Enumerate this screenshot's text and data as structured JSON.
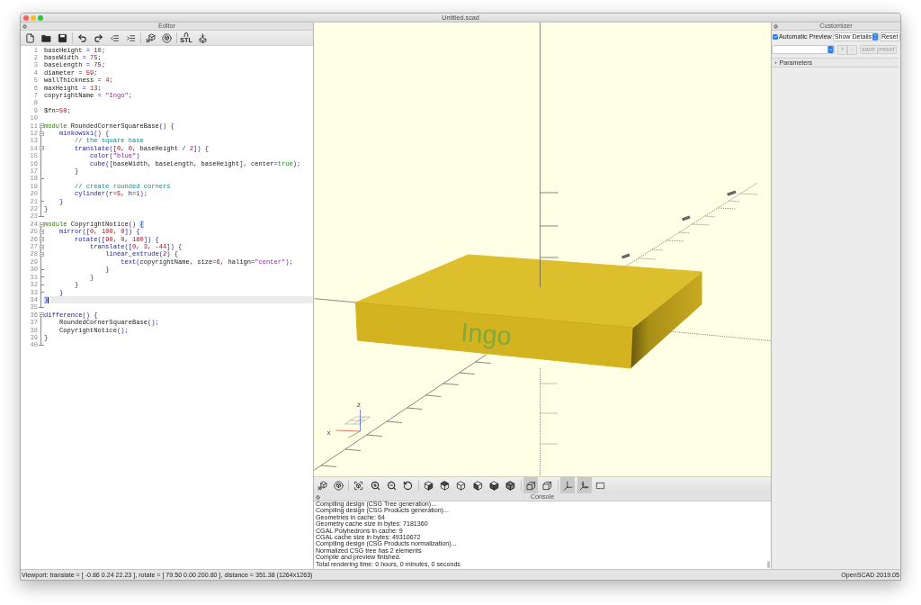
{
  "window": {
    "title": "Untitled.scad"
  },
  "editor": {
    "title": "Editor",
    "toolbar": {
      "groups": [
        [
          {
            "kind": "new"
          },
          {
            "kind": "open"
          },
          {
            "kind": "save"
          }
        ],
        [
          {
            "kind": "undo"
          },
          {
            "kind": "redo"
          },
          {
            "kind": "unindent"
          },
          {
            "kind": "indent"
          }
        ],
        [
          {
            "kind": "preview"
          },
          {
            "kind": "render"
          }
        ],
        [
          {
            "kind": "export_stl",
            "label": "STL"
          },
          {
            "kind": "print"
          }
        ]
      ]
    },
    "lines": [
      {
        "number": "1",
        "kind": "plain",
        "current": false,
        "tokens": [
          {
            "kind": "id",
            "text": "baseHeight"
          },
          {
            "kind": "op",
            "text": " = "
          },
          {
            "kind": "num",
            "text": "10"
          },
          {
            "kind": "op",
            "text": ";"
          }
        ]
      },
      {
        "number": "2",
        "kind": "plain",
        "current": false,
        "tokens": [
          {
            "kind": "id",
            "text": "baseWidth"
          },
          {
            "kind": "op",
            "text": " = "
          },
          {
            "kind": "num",
            "text": "75"
          },
          {
            "kind": "op",
            "text": ";"
          }
        ]
      },
      {
        "number": "3",
        "kind": "plain",
        "current": false,
        "tokens": [
          {
            "kind": "id",
            "text": "baseLength"
          },
          {
            "kind": "op",
            "text": " = "
          },
          {
            "kind": "num",
            "text": "75"
          },
          {
            "kind": "op",
            "text": ";"
          }
        ]
      },
      {
        "number": "4",
        "kind": "plain",
        "current": false,
        "tokens": [
          {
            "kind": "id",
            "text": "diameter"
          },
          {
            "kind": "op",
            "text": " = "
          },
          {
            "kind": "num",
            "text": "59"
          },
          {
            "kind": "op",
            "text": ";"
          }
        ]
      },
      {
        "number": "5",
        "kind": "plain",
        "current": false,
        "tokens": [
          {
            "kind": "id",
            "text": "wallThickness"
          },
          {
            "kind": "op",
            "text": " = "
          },
          {
            "kind": "num",
            "text": "4"
          },
          {
            "kind": "op",
            "text": ";"
          }
        ]
      },
      {
        "number": "6",
        "kind": "plain",
        "current": false,
        "tokens": [
          {
            "kind": "id",
            "text": "maxHeight"
          },
          {
            "kind": "op",
            "text": " = "
          },
          {
            "kind": "num",
            "text": "13"
          },
          {
            "kind": "op",
            "text": ";"
          }
        ]
      },
      {
        "number": "7",
        "kind": "plain",
        "current": false,
        "tokens": [
          {
            "kind": "id",
            "text": "copyrightName"
          },
          {
            "kind": "op",
            "text": " = "
          },
          {
            "kind": "str",
            "text": "\"Ingo\""
          },
          {
            "kind": "op",
            "text": ";"
          }
        ]
      },
      {
        "number": "8",
        "kind": "plain",
        "current": false
      },
      {
        "number": "9",
        "kind": "plain",
        "current": false,
        "tokens": [
          {
            "kind": "id",
            "text": "$fn"
          },
          {
            "kind": "op",
            "text": "="
          },
          {
            "kind": "num",
            "text": "50"
          },
          {
            "kind": "op",
            "text": ";"
          }
        ]
      },
      {
        "number": "10",
        "kind": "plain",
        "current": false
      },
      {
        "number": "11",
        "kind": "start",
        "current": false,
        "tokens": [
          {
            "kind": "kw",
            "text": "module"
          },
          {
            "kind": "id",
            "text": " RoundedCornerSquareBase"
          },
          {
            "kind": "op",
            "text": "() {"
          }
        ]
      },
      {
        "number": "12",
        "kind": "start",
        "current": false,
        "tokens": [
          {
            "kind": "fn",
            "text": "    minkowski"
          },
          {
            "kind": "op",
            "text": "() {"
          }
        ]
      },
      {
        "number": "13",
        "kind": "body",
        "current": false,
        "tokens": [
          {
            "kind": "cmt",
            "text": "        // the square base"
          }
        ]
      },
      {
        "number": "14",
        "kind": "start",
        "current": false,
        "tokens": [
          {
            "kind": "fn",
            "text": "        translate"
          },
          {
            "kind": "op",
            "text": "(["
          },
          {
            "kind": "num",
            "text": "0"
          },
          {
            "kind": "op",
            "text": ", "
          },
          {
            "kind": "num",
            "text": "0"
          },
          {
            "kind": "op",
            "text": ", "
          },
          {
            "kind": "id",
            "text": "baseHeight"
          },
          {
            "kind": "op",
            "text": " / "
          },
          {
            "kind": "num",
            "text": "2"
          },
          {
            "kind": "op",
            "text": "]) {"
          }
        ]
      },
      {
        "number": "15",
        "kind": "body",
        "current": false,
        "tokens": [
          {
            "kind": "fn",
            "text": "            color"
          },
          {
            "kind": "op",
            "text": "("
          },
          {
            "kind": "str",
            "text": "\"blue\""
          },
          {
            "kind": "op",
            "text": ")"
          }
        ]
      },
      {
        "number": "16",
        "kind": "body",
        "current": false,
        "tokens": [
          {
            "kind": "fn",
            "text": "            cube"
          },
          {
            "kind": "op",
            "text": "(["
          },
          {
            "kind": "id",
            "text": "baseWidth"
          },
          {
            "kind": "op",
            "text": ", "
          },
          {
            "kind": "id",
            "text": "baseLength"
          },
          {
            "kind": "op",
            "text": ", "
          },
          {
            "kind": "id",
            "text": "baseHeight"
          },
          {
            "kind": "op",
            "text": "], "
          },
          {
            "kind": "id",
            "text": "center"
          },
          {
            "kind": "op",
            "text": "="
          },
          {
            "kind": "bool",
            "text": "true"
          },
          {
            "kind": "op",
            "text": ");"
          }
        ]
      },
      {
        "number": "17",
        "kind": "body",
        "current": false,
        "tokens": [
          {
            "kind": "op",
            "text": "        }"
          }
        ]
      },
      {
        "number": "18",
        "kind": "tick",
        "current": false
      },
      {
        "number": "19",
        "kind": "body",
        "current": false,
        "tokens": [
          {
            "kind": "cmt",
            "text": "        // create rounded corners"
          }
        ]
      },
      {
        "number": "20",
        "kind": "body",
        "current": false,
        "tokens": [
          {
            "kind": "fn",
            "text": "        cylinder"
          },
          {
            "kind": "op",
            "text": "("
          },
          {
            "kind": "id",
            "text": "r"
          },
          {
            "kind": "op",
            "text": "="
          },
          {
            "kind": "num",
            "text": "5"
          },
          {
            "kind": "op",
            "text": ", "
          },
          {
            "kind": "id",
            "text": "h"
          },
          {
            "kind": "op",
            "text": "="
          },
          {
            "kind": "num",
            "text": "1"
          },
          {
            "kind": "op",
            "text": ");"
          }
        ]
      },
      {
        "number": "21",
        "kind": "tick",
        "current": false,
        "tokens": [
          {
            "kind": "op",
            "text": "    }"
          }
        ]
      },
      {
        "number": "22",
        "kind": "body",
        "current": false,
        "tokens": [
          {
            "kind": "op",
            "text": "}"
          }
        ]
      },
      {
        "number": "23",
        "kind": "end",
        "current": false
      },
      {
        "number": "24",
        "kind": "start",
        "current": false,
        "tokens": [
          {
            "kind": "kw",
            "text": "module"
          },
          {
            "kind": "id",
            "text": " CopyrightNotice"
          },
          {
            "kind": "op",
            "text": "() "
          },
          {
            "kind": "match",
            "text": "{"
          }
        ]
      },
      {
        "number": "25",
        "kind": "start",
        "current": false,
        "tokens": [
          {
            "kind": "fn",
            "text": "    mirror"
          },
          {
            "kind": "op",
            "text": "(["
          },
          {
            "kind": "num",
            "text": "0"
          },
          {
            "kind": "op",
            "text": ", "
          },
          {
            "kind": "num",
            "text": "100"
          },
          {
            "kind": "op",
            "text": ", "
          },
          {
            "kind": "num",
            "text": "0"
          },
          {
            "kind": "op",
            "text": "]) {"
          }
        ]
      },
      {
        "number": "26",
        "kind": "start",
        "current": false,
        "tokens": [
          {
            "kind": "fn",
            "text": "        rotate"
          },
          {
            "kind": "op",
            "text": "(["
          },
          {
            "kind": "num",
            "text": "90"
          },
          {
            "kind": "op",
            "text": ", "
          },
          {
            "kind": "num",
            "text": "0"
          },
          {
            "kind": "op",
            "text": ", "
          },
          {
            "kind": "num",
            "text": "180"
          },
          {
            "kind": "op",
            "text": "]) {"
          }
        ]
      },
      {
        "number": "27",
        "kind": "start",
        "current": false,
        "tokens": [
          {
            "kind": "fn",
            "text": "            translate"
          },
          {
            "kind": "op",
            "text": "(["
          },
          {
            "kind": "num",
            "text": "0"
          },
          {
            "kind": "op",
            "text": ", "
          },
          {
            "kind": "num",
            "text": "3"
          },
          {
            "kind": "op",
            "text": ", "
          },
          {
            "kind": "num",
            "text": "-44"
          },
          {
            "kind": "op",
            "text": "]) {"
          }
        ]
      },
      {
        "number": "28",
        "kind": "start",
        "current": false,
        "tokens": [
          {
            "kind": "fn",
            "text": "                linear_extrude"
          },
          {
            "kind": "op",
            "text": "("
          },
          {
            "kind": "num",
            "text": "2"
          },
          {
            "kind": "op",
            "text": ") {"
          }
        ]
      },
      {
        "number": "29",
        "kind": "body",
        "current": false,
        "tokens": [
          {
            "kind": "fn",
            "text": "                    text"
          },
          {
            "kind": "op",
            "text": "("
          },
          {
            "kind": "id",
            "text": "copyrightName"
          },
          {
            "kind": "op",
            "text": ", "
          },
          {
            "kind": "id",
            "text": "size"
          },
          {
            "kind": "op",
            "text": "="
          },
          {
            "kind": "num",
            "text": "6"
          },
          {
            "kind": "op",
            "text": ", "
          },
          {
            "kind": "id",
            "text": "halign"
          },
          {
            "kind": "op",
            "text": "="
          },
          {
            "kind": "str",
            "text": "\"center\""
          },
          {
            "kind": "op",
            "text": ");"
          }
        ]
      },
      {
        "number": "30",
        "kind": "tick",
        "current": false,
        "tokens": [
          {
            "kind": "op",
            "text": "                }"
          }
        ]
      },
      {
        "number": "31",
        "kind": "tick",
        "current": false,
        "tokens": [
          {
            "kind": "op",
            "text": "            }"
          }
        ]
      },
      {
        "number": "32",
        "kind": "tick",
        "current": false,
        "tokens": [
          {
            "kind": "op",
            "text": "        }"
          }
        ]
      },
      {
        "number": "33",
        "kind": "tick",
        "current": false,
        "tokens": [
          {
            "kind": "op",
            "text": "    }"
          }
        ]
      },
      {
        "number": "34",
        "kind": "body",
        "current": true,
        "tokens": [
          {
            "kind": "match",
            "text": "}"
          }
        ]
      },
      {
        "number": "35",
        "kind": "end",
        "current": false
      },
      {
        "number": "36",
        "kind": "start",
        "current": false,
        "tokens": [
          {
            "kind": "fn",
            "text": "difference"
          },
          {
            "kind": "op",
            "text": "() {"
          }
        ]
      },
      {
        "number": "37",
        "kind": "body",
        "current": false,
        "tokens": [
          {
            "kind": "id",
            "text": "    RoundedCornerSquareBase"
          },
          {
            "kind": "op",
            "text": "();"
          }
        ]
      },
      {
        "number": "38",
        "kind": "body",
        "current": false,
        "tokens": [
          {
            "kind": "id",
            "text": "    CopyrightNotice"
          },
          {
            "kind": "op",
            "text": "();"
          }
        ]
      },
      {
        "number": "39",
        "kind": "body",
        "current": false,
        "tokens": [
          {
            "kind": "op",
            "text": "}"
          }
        ]
      },
      {
        "number": "40",
        "kind": "end",
        "current": false
      }
    ]
  },
  "viewport": {
    "model_label": "Ingo",
    "axis_labels": [
      "z",
      "x"
    ],
    "toolbar": {
      "groups": [
        [
          {
            "kind": "preview"
          },
          {
            "kind": "render"
          }
        ],
        [
          {
            "kind": "view_all"
          },
          {
            "kind": "zoom_in"
          },
          {
            "kind": "zoom_out"
          },
          {
            "kind": "reset_view"
          }
        ],
        [
          {
            "kind": "view_right"
          },
          {
            "kind": "view_top"
          },
          {
            "kind": "view_bottom"
          },
          {
            "kind": "view_left"
          },
          {
            "kind": "view_front"
          },
          {
            "kind": "view_back"
          }
        ],
        [
          {
            "kind": "perspective",
            "on": true
          },
          {
            "kind": "orthogonal",
            "on": false
          }
        ],
        [
          {
            "kind": "show_axes",
            "on": true
          },
          {
            "kind": "show_scale",
            "on": true
          },
          {
            "kind": "show_edges",
            "on": false
          }
        ]
      ]
    }
  },
  "console": {
    "title": "Console",
    "lines": [
      "Compiling design (CSG Tree generation)...",
      "Compiling design (CSG Products generation)...",
      "Geometries in cache: 64",
      "Geometry cache size in bytes: 7181360",
      "CGAL Polyhedrons in cache: 9",
      "CGAL cache size in bytes: 49310672",
      "Compiling design (CSG Products normalization)...",
      "Normalized CSG tree has 2 elements",
      "Compile and preview finished.",
      "Total rendering time: 0 hours, 0 minutes, 0 seconds"
    ]
  },
  "customizer": {
    "title": "Customizer",
    "auto_preview": {
      "label": "Automatic Preview",
      "checked": true
    },
    "detail_select": {
      "value": "Show Details"
    },
    "reset_button": {
      "label": "Reset"
    },
    "preset_buttons": [
      {
        "label": "+",
        "disabled": true
      },
      {
        "label": "-",
        "disabled": true
      },
      {
        "label": "save preset",
        "disabled": true
      }
    ],
    "parameters": {
      "label": "Parameters",
      "expanded": false
    }
  },
  "status_bar": {
    "viewport": "Viewport: translate = [ -0.86 0.24 22.23 ], rotate = [ 79.50 0.00 200.80 ], distance = 351.38 (1264x1263)",
    "version": "OpenSCAD 2019.05"
  }
}
